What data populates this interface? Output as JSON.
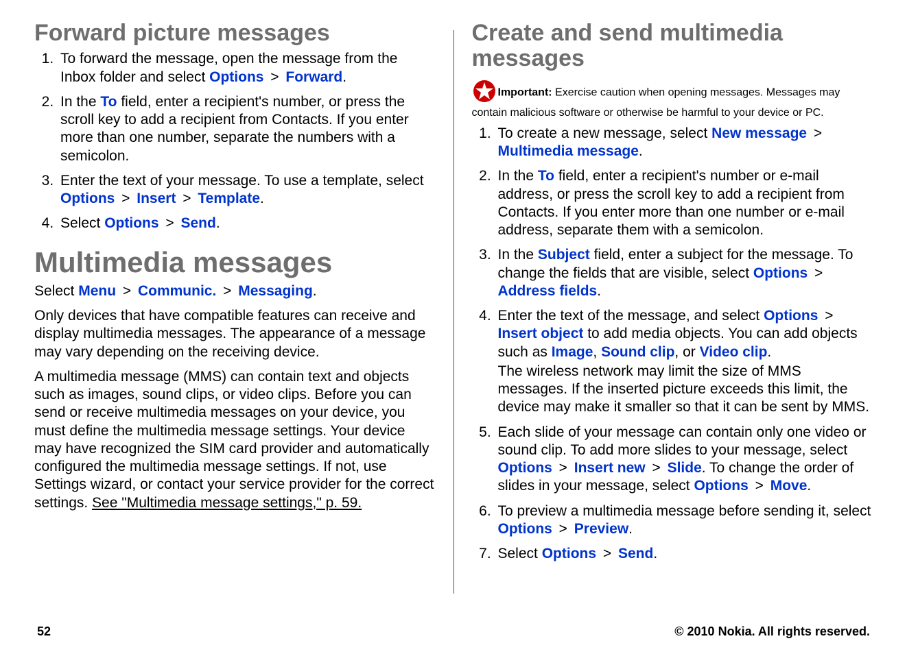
{
  "left": {
    "h_forward": "Forward picture messages",
    "forward_steps": [
      {
        "pre": "To forward the message, open the message from the Inbox folder and select ",
        "seq": [
          {
            "t": "Options",
            "k": "link"
          },
          {
            "t": " > ",
            "k": "gt"
          },
          {
            "t": "Forward",
            "k": "link"
          }
        ],
        "post": "."
      },
      {
        "pre": "In the ",
        "seq": [
          {
            "t": "To",
            "k": "link"
          }
        ],
        "post": " field, enter a recipient's number, or press the scroll key to add a recipient from Contacts. If you enter more than one number, separate the numbers with a semicolon."
      },
      {
        "pre": "Enter the text of your message. To use a template, select ",
        "seq": [
          {
            "t": "Options",
            "k": "link"
          },
          {
            "t": " > ",
            "k": "gt"
          },
          {
            "t": "Insert",
            "k": "link"
          },
          {
            "t": " > ",
            "k": "gt"
          },
          {
            "t": "Template",
            "k": "link"
          }
        ],
        "post": "."
      },
      {
        "pre": "Select ",
        "seq": [
          {
            "t": "Options",
            "k": "link"
          },
          {
            "t": " > ",
            "k": "gt"
          },
          {
            "t": "Send",
            "k": "link"
          }
        ],
        "post": "."
      }
    ],
    "h_mms": "Multimedia messages",
    "nav_pre": "Select ",
    "nav_seq": [
      {
        "t": "Menu",
        "k": "link"
      },
      {
        "t": " > ",
        "k": "gt"
      },
      {
        "t": "Communic.",
        "k": "link"
      },
      {
        "t": " > ",
        "k": "gt"
      },
      {
        "t": "Messaging",
        "k": "link"
      }
    ],
    "nav_post": ".",
    "p1": "Only devices that have compatible features can receive and display multimedia messages. The appearance of a message may vary depending on the receiving device.",
    "p2_pre": "A multimedia message (MMS) can contain text and objects such as images, sound clips, or video clips. Before you can send or receive multimedia messages on your device, you must define the multimedia message settings. Your device may have recognized the SIM card provider and automatically configured the multimedia message settings. If not, use Settings wizard, or contact your service provider for the correct settings. ",
    "p2_link": "See \"Multimedia message settings,\" p. 59."
  },
  "right": {
    "h_create": "Create and send multimedia messages",
    "important_label": "Important:",
    "important_text": "  Exercise caution when opening messages. Messages may contain malicious software or otherwise be harmful to your device or PC.",
    "steps": [
      {
        "pre": "To create a new message, select ",
        "seq": [
          {
            "t": "New message",
            "k": "link"
          },
          {
            "t": " > ",
            "k": "gt"
          },
          {
            "t": "Multimedia message",
            "k": "link"
          }
        ],
        "post": "."
      },
      {
        "pre": "In the ",
        "seq": [
          {
            "t": "To",
            "k": "link"
          }
        ],
        "post": " field, enter a recipient's number or e-mail address, or press the scroll key to add a recipient from Contacts. If you enter more than one number or e-mail address, separate them with a semicolon."
      },
      {
        "pre": "In the ",
        "seq": [
          {
            "t": "Subject",
            "k": "link"
          }
        ],
        "post_a": " field, enter a subject for the message. To change the fields that are visible, select ",
        "seq2": [
          {
            "t": "Options",
            "k": "link"
          },
          {
            "t": " > ",
            "k": "gt"
          },
          {
            "t": "Address fields",
            "k": "link"
          }
        ],
        "post": "."
      },
      {
        "pre": "Enter the text of the message, and select ",
        "seq": [
          {
            "t": "Options",
            "k": "link"
          },
          {
            "t": " > ",
            "k": "gt"
          },
          {
            "t": "Insert object",
            "k": "link"
          }
        ],
        "post_a": " to add media objects. You can add objects such as ",
        "seq2": [
          {
            "t": "Image",
            "k": "link"
          },
          {
            "t": ", ",
            "k": "plain"
          },
          {
            "t": "Sound clip",
            "k": "link"
          },
          {
            "t": ", or ",
            "k": "plain"
          },
          {
            "t": "Video clip",
            "k": "link"
          }
        ],
        "post": ".",
        "note": "The wireless network may limit the size of MMS messages. If the inserted picture exceeds this limit, the device may make it smaller so that it can be sent by MMS."
      },
      {
        "pre": "Each slide of your message can contain only one video or sound clip. To add more slides to your message, select ",
        "seq": [
          {
            "t": "Options",
            "k": "link"
          },
          {
            "t": " > ",
            "k": "gt"
          },
          {
            "t": "Insert new",
            "k": "link"
          },
          {
            "t": " > ",
            "k": "gt"
          },
          {
            "t": "Slide",
            "k": "link"
          }
        ],
        "post_a": ". To change the order of slides in your message, select ",
        "seq2": [
          {
            "t": "Options",
            "k": "link"
          },
          {
            "t": " > ",
            "k": "gt"
          },
          {
            "t": "Move",
            "k": "link"
          }
        ],
        "post": "."
      },
      {
        "pre": "To preview a multimedia message before sending it, select ",
        "seq": [
          {
            "t": "Options",
            "k": "link"
          },
          {
            "t": " > ",
            "k": "gt"
          },
          {
            "t": "Preview",
            "k": "link"
          }
        ],
        "post": "."
      },
      {
        "pre": "Select ",
        "seq": [
          {
            "t": "Options",
            "k": "link"
          },
          {
            "t": " > ",
            "k": "gt"
          },
          {
            "t": "Send",
            "k": "link"
          }
        ],
        "post": "."
      }
    ]
  },
  "footer": {
    "page": "52",
    "copyright": "© 2010 Nokia. All rights reserved."
  }
}
